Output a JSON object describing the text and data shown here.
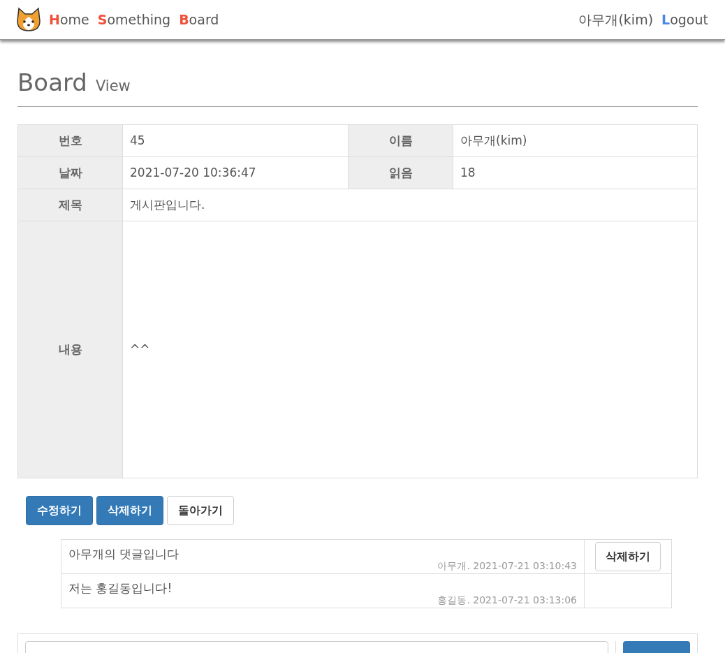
{
  "nav": {
    "links": [
      {
        "initial": "H",
        "rest": "ome"
      },
      {
        "initial": "S",
        "rest": "omething"
      },
      {
        "initial": "B",
        "rest": "oard"
      }
    ],
    "user": "아무개(kim)",
    "logout": {
      "initial": "L",
      "rest": "ogout"
    }
  },
  "heading": {
    "title": "Board",
    "subtitle": "View"
  },
  "fields": [
    {
      "label": "번호",
      "value": "45"
    },
    {
      "label": "이름",
      "value": "아무개(kim)"
    },
    {
      "label": "날짜",
      "value": "2021-07-20 10:36:47"
    },
    {
      "label": "읽음",
      "value": "18"
    }
  ],
  "subject": {
    "label": "제목",
    "value": "게시판입니다."
  },
  "body": {
    "label": "내용",
    "value": "^^"
  },
  "buttons": [
    {
      "label": "수정하기",
      "kind": "primary"
    },
    {
      "label": "삭제하기",
      "kind": "primary"
    },
    {
      "label": "돌아가기",
      "kind": "default"
    }
  ],
  "comments": [
    {
      "text": "아무개의 댓글입니다",
      "meta": "아무개. 2021-07-21 03:10:43",
      "delete_label": "삭제하기"
    },
    {
      "text": "저는 홍길동입니다!",
      "meta": "홍길동. 2021-07-21 03:13:06"
    }
  ]
}
